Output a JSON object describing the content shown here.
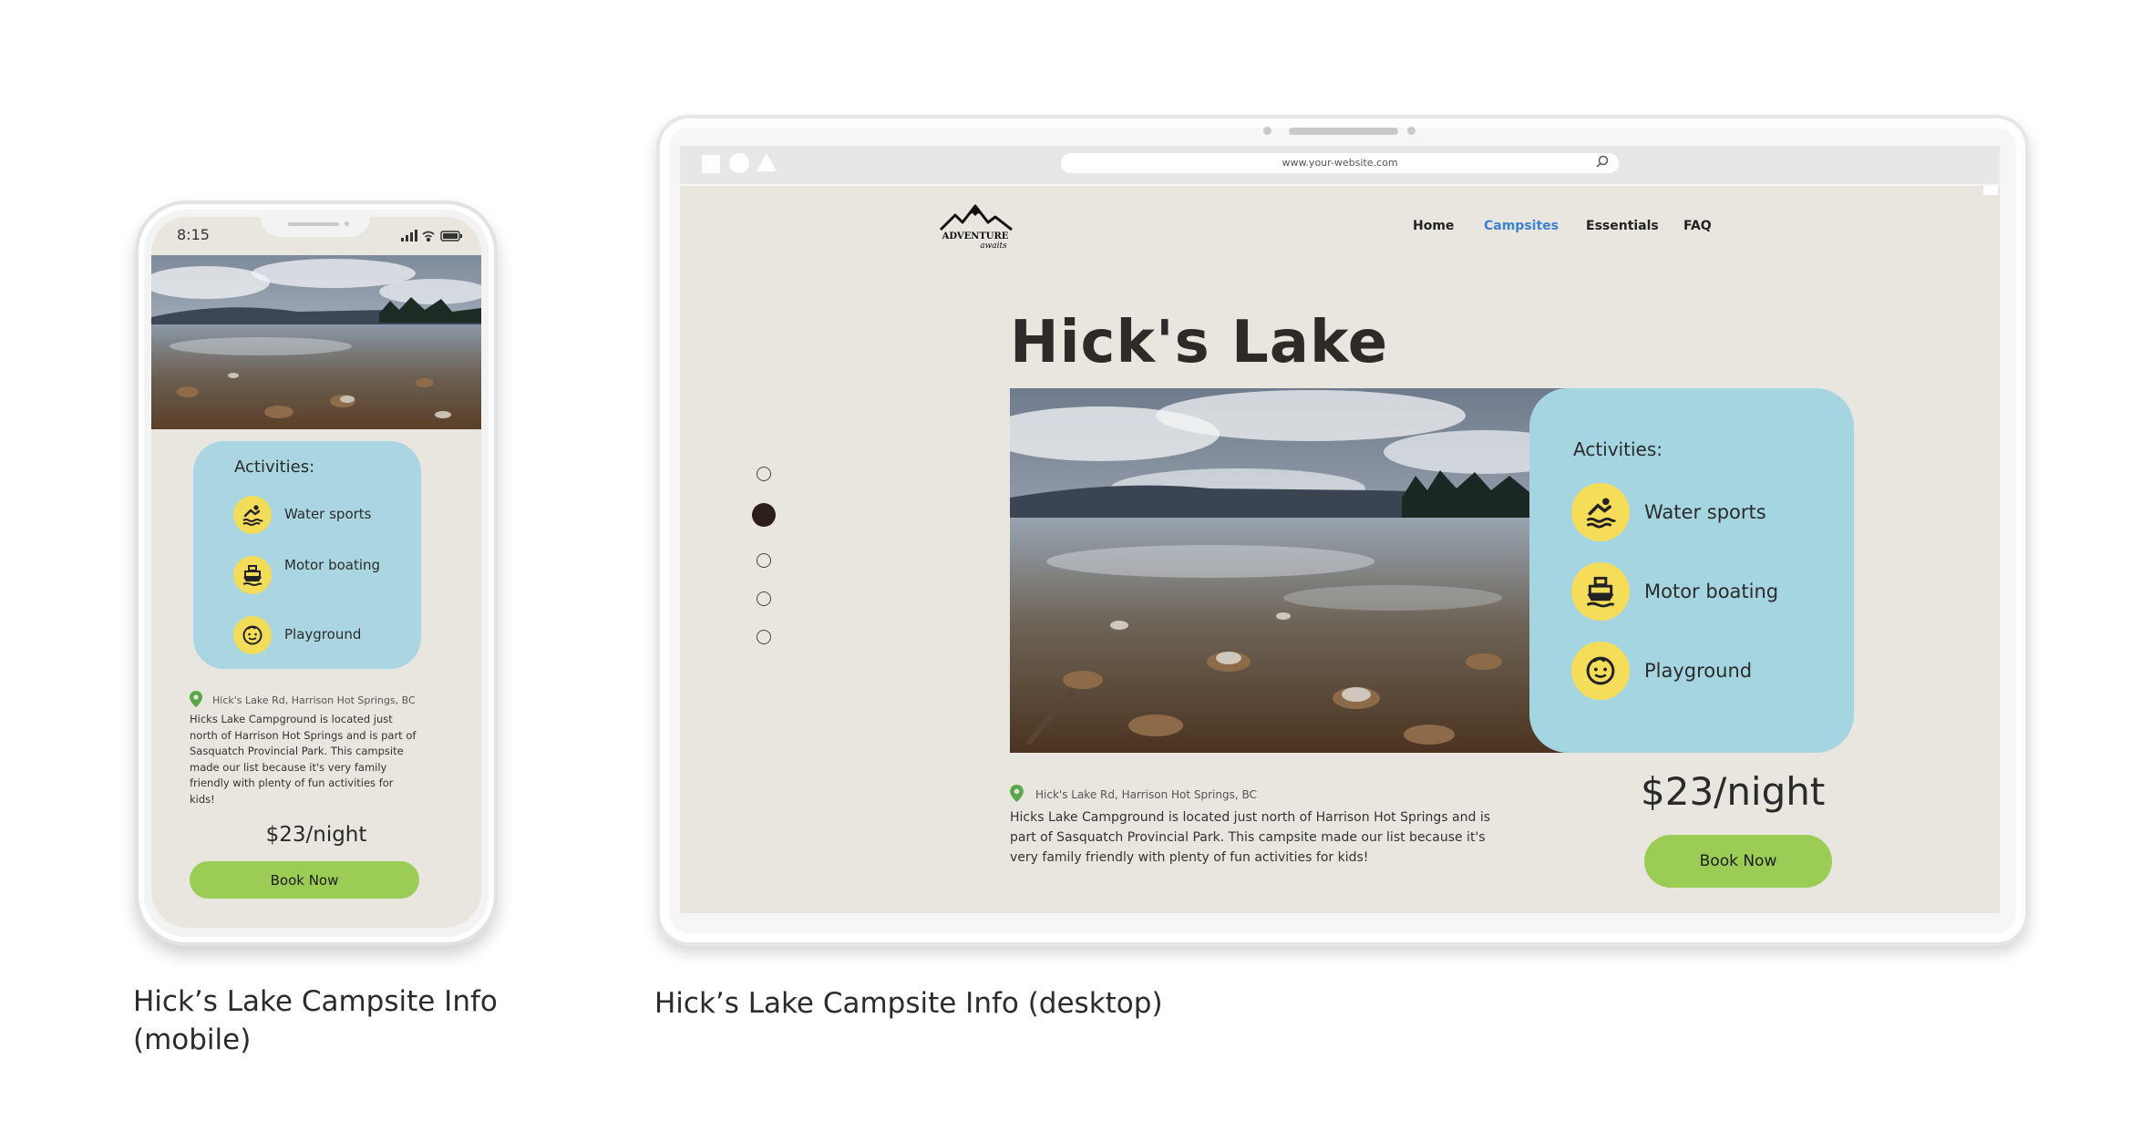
{
  "mobile": {
    "status": {
      "time": "8:15"
    },
    "activities": {
      "title": "Activities:",
      "items": [
        {
          "label": "Water sports",
          "icon": "swimmer-icon"
        },
        {
          "label": "Motor boating",
          "icon": "boat-icon"
        },
        {
          "label": "Playground",
          "icon": "child-face-icon"
        }
      ]
    },
    "address": "Hick's Lake Rd, Harrison Hot Springs, BC",
    "description": "Hicks Lake Campground is located just north of Harrison Hot Springs and is part of Sasquatch Provincial Park. This campsite made our list because it's very family friendly with plenty of fun activities for kids!",
    "price": "$23/night",
    "book_label": "Book Now",
    "caption": "Hick’s Lake Campsite Info (mobile)"
  },
  "desktop": {
    "browser": {
      "url": "www.your-website.com"
    },
    "nav": {
      "logo_alt": "ADVENTURE awaits",
      "items": [
        {
          "label": "Home",
          "active": false
        },
        {
          "label": "Campsites",
          "active": true
        },
        {
          "label": "Essentials",
          "active": false
        },
        {
          "label": "FAQ",
          "active": false
        }
      ]
    },
    "title": "Hick's Lake",
    "carousel": {
      "count": 5,
      "active_index": 1
    },
    "activities": {
      "title": "Activities:",
      "items": [
        {
          "label": "Water sports",
          "icon": "swimmer-icon"
        },
        {
          "label": "Motor boating",
          "icon": "boat-icon"
        },
        {
          "label": "Playground",
          "icon": "child-face-icon"
        }
      ]
    },
    "address": "Hick's Lake Rd, Harrison Hot Springs, BC",
    "description": "Hicks Lake Campground is located just north of Harrison Hot Springs and is part of Sasquatch Provincial Park. This campsite made our list because it's very family friendly with plenty of fun activities for kids!",
    "price": "$23/night",
    "book_label": "Book Now",
    "caption": "Hick’s Lake Campsite Info (desktop)"
  },
  "colors": {
    "page_bg": "#e9e6df",
    "card_blue": "#a5d5e1",
    "icon_yellow": "#f5dd5a",
    "button_green": "#9bcc55",
    "nav_active": "#3b82d6"
  }
}
